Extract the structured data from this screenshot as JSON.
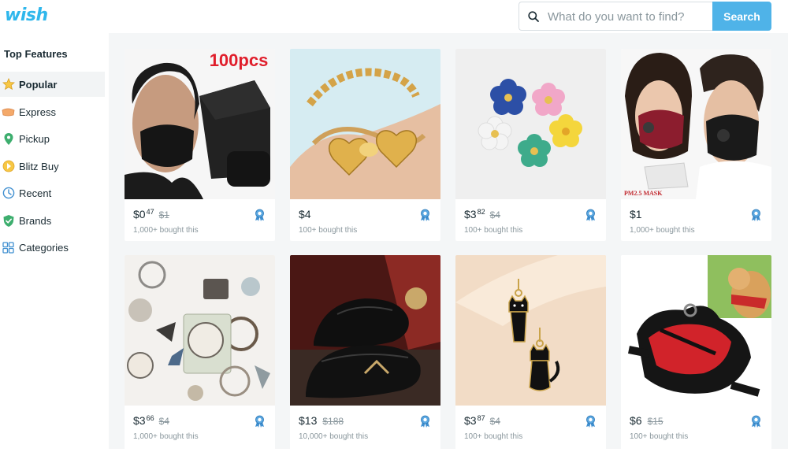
{
  "header": {
    "logo": "wish",
    "search": {
      "placeholder": "What do you want to find?",
      "button_label": "Search"
    }
  },
  "sidebar": {
    "title": "Top Features",
    "items": [
      {
        "label": "Popular",
        "icon": "star-icon",
        "active": true
      },
      {
        "label": "Express",
        "icon": "express-icon",
        "active": false
      },
      {
        "label": "Pickup",
        "icon": "pickup-pin-icon",
        "active": false
      },
      {
        "label": "Blitz Buy",
        "icon": "blitz-buy-icon",
        "active": false
      },
      {
        "label": "Recent",
        "icon": "clock-icon",
        "active": false
      },
      {
        "label": "Brands",
        "icon": "brand-shield-icon",
        "active": false
      },
      {
        "label": "Categories",
        "icon": "grid-icon",
        "active": false
      }
    ]
  },
  "products": [
    {
      "image": "black-face-masks",
      "image_text": "100pcs",
      "price_main": "$0",
      "price_cents": "47",
      "price_orig": "$1",
      "bought": "1,000+ bought this"
    },
    {
      "image": "gold-heart-bracelet",
      "price_main": "$4",
      "price_cents": "",
      "price_orig": "",
      "bought": "100+ bought this"
    },
    {
      "image": "flower-earrings",
      "price_main": "$3",
      "price_cents": "82",
      "price_orig": "$4",
      "bought": "100+ bought this"
    },
    {
      "image": "pm25-face-masks",
      "image_text": "PM2.5 MASK",
      "price_main": "$1",
      "price_cents": "",
      "price_orig": "",
      "bought": "1,000+ bought this"
    },
    {
      "image": "vintage-stickers",
      "price_main": "$3",
      "price_cents": "66",
      "price_orig": "$4",
      "bought": "1,000+ bought this"
    },
    {
      "image": "black-leather-shoes",
      "price_main": "$13",
      "price_cents": "",
      "price_orig": "$188",
      "bought": "10,000+ bought this"
    },
    {
      "image": "cat-earrings",
      "price_main": "$3",
      "price_cents": "87",
      "price_orig": "$4",
      "bought": "100+ bought this"
    },
    {
      "image": "dog-harness",
      "price_main": "$6",
      "price_cents": "",
      "price_orig": "$15",
      "bought": "100+ bought this"
    }
  ],
  "colors": {
    "brand": "#2fb7ec",
    "search_button": "#4fb3e8",
    "grid_background": "#f4f6f7",
    "muted_text": "#8a979d"
  }
}
